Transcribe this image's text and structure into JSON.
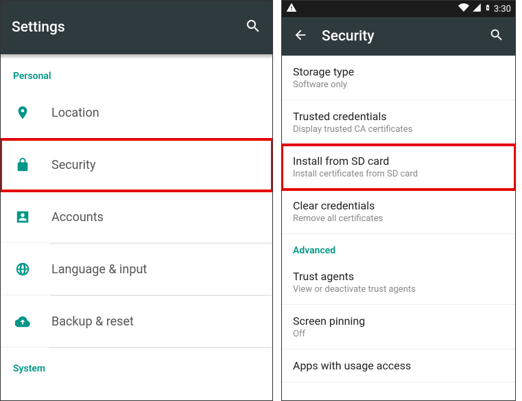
{
  "left": {
    "appbar_title": "Settings",
    "section_personal": "Personal",
    "items": [
      {
        "label": "Location"
      },
      {
        "label": "Security"
      },
      {
        "label": "Accounts"
      },
      {
        "label": "Language & input"
      },
      {
        "label": "Backup & reset"
      }
    ],
    "section_system": "System"
  },
  "right": {
    "status_time": "3:30",
    "appbar_title": "Security",
    "items": [
      {
        "title": "Storage type",
        "sub": "Software only"
      },
      {
        "title": "Trusted credentials",
        "sub": "Display trusted CA certificates"
      },
      {
        "title": "Install from SD card",
        "sub": "Install certificates from SD card"
      },
      {
        "title": "Clear credentials",
        "sub": "Remove all certificates"
      }
    ],
    "section_advanced": "Advanced",
    "adv_items": [
      {
        "title": "Trust agents",
        "sub": "View or deactivate trust agents"
      },
      {
        "title": "Screen pinning",
        "sub": "Off"
      },
      {
        "title": "Apps with usage access",
        "sub": ""
      }
    ]
  }
}
